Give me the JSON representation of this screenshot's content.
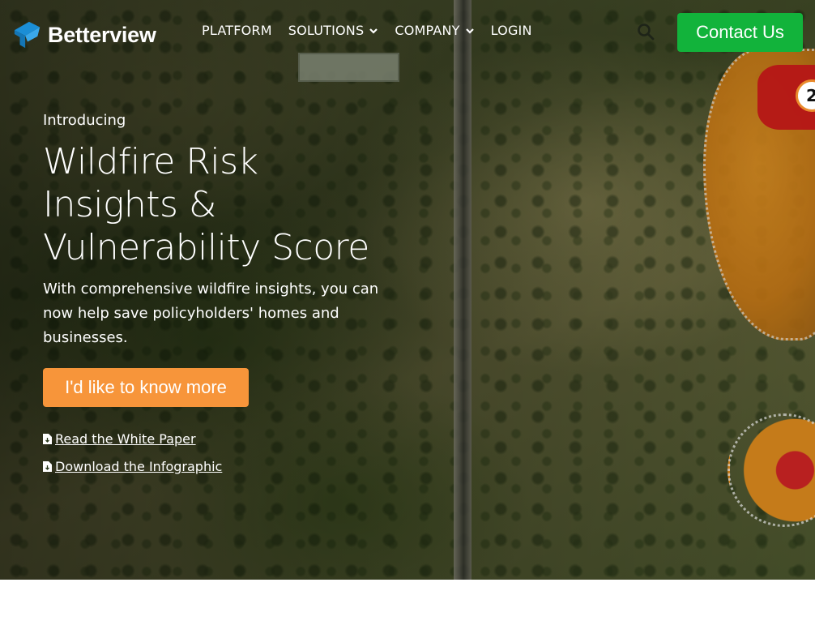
{
  "brand": {
    "name": "Betterview"
  },
  "nav": {
    "items": [
      {
        "label": "PLATFORM",
        "has_dropdown": false
      },
      {
        "label": "SOLUTIONS",
        "has_dropdown": true
      },
      {
        "label": "COMPANY",
        "has_dropdown": true
      },
      {
        "label": "LOGIN",
        "has_dropdown": false
      }
    ],
    "search_icon": "search-icon",
    "contact_label": "Contact Us"
  },
  "hero": {
    "eyebrow": "Introducing",
    "headline_lines": [
      "Wildfire Risk",
      "Insights &",
      "Vulnerability Score"
    ],
    "subheadline": "With comprehensive wildfire insights, you can now help save policyholders' homes and businesses.",
    "cta_label": "I'd like to know more",
    "resources": [
      {
        "label": "Read the White Paper",
        "icon": "document-icon"
      },
      {
        "label": "Download the Infographic",
        "icon": "document-icon"
      }
    ],
    "map_marker_label": "2"
  },
  "colors": {
    "contact_button": "#12b33b",
    "cta_button": "#f7953a",
    "logo_blue": "#1b8ed6",
    "marker_border": "#e98b2c"
  }
}
